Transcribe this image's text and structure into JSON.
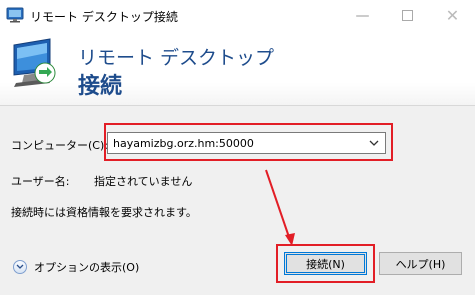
{
  "window": {
    "title": "リモート デスクトップ接続"
  },
  "banner": {
    "line1": "リモート デスクトップ",
    "line2": "接続"
  },
  "computer": {
    "label": "コンピューター(C):",
    "value": "hayamizbg.orz.hm:50000"
  },
  "user": {
    "label": "ユーザー名:",
    "value": "指定されていません"
  },
  "prompt": "接続時には資格情報を要求されます。",
  "options": {
    "label": "オプションの表示(O)"
  },
  "buttons": {
    "connect": "接続(N)",
    "help": "ヘルプ(H)"
  },
  "colors": {
    "annotation": "#e21e26",
    "accent": "#1e4c8c",
    "focus": "#0078d7"
  },
  "icons": [
    "app-icon",
    "remote-desktop-logo",
    "chevron-down-icon",
    "options-chevron-icon",
    "annotation-arrow"
  ]
}
